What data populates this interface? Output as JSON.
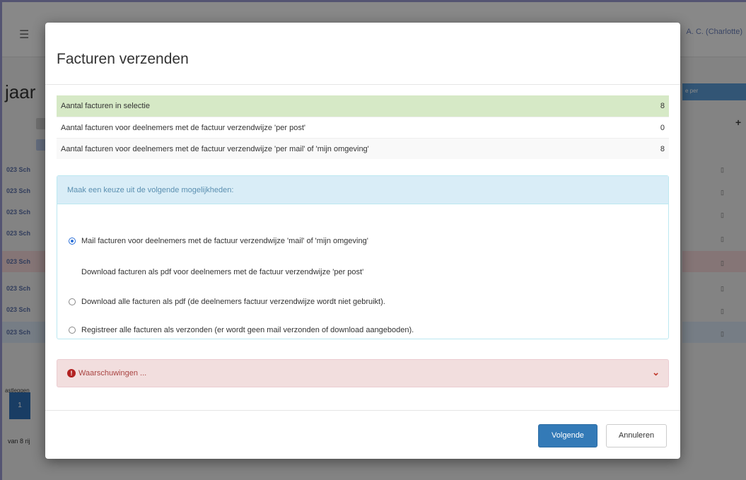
{
  "background": {
    "user_label": "A. C. (Charlotte)",
    "page_title": "jaar",
    "right_bar_label": "e per",
    "row_labels": [
      "023  Sch",
      "023  Sch",
      "023  Sch",
      "023  Sch",
      "023  Sch",
      "023  Sch",
      "023  Sch",
      "023  Sch"
    ],
    "bottom_small": "astleggen",
    "page_number": "1",
    "rows_count": "van 8 rij"
  },
  "modal": {
    "title": "Facturen verzenden",
    "stats": [
      {
        "label": "Aantal facturen in selectie",
        "value": "8"
      },
      {
        "label": "Aantal facturen voor deelnemers met de factuur verzendwijze 'per post'",
        "value": "0"
      },
      {
        "label": "Aantal facturen voor deelnemers met de factuur verzendwijze 'per mail' of 'mijn omgeving'",
        "value": "8"
      }
    ],
    "choice_header": "Maak een keuze uit de volgende mogelijkheden:",
    "options": [
      {
        "label": "Mail facturen voor deelnemers met de factuur verzendwijze 'mail' of 'mijn omgeving'",
        "selected": true
      },
      {
        "label": "Download facturen als pdf voor deelnemers met de factuur verzendwijze 'per post'",
        "selected": false
      },
      {
        "label": "Download alle facturen als pdf (de deelnemers factuur verzendwijze wordt niet gebruikt).",
        "selected": false
      },
      {
        "label": "Registreer alle facturen als verzonden (er wordt geen mail verzonden of download aangeboden).",
        "selected": false
      }
    ],
    "warnings_label": "Waarschuwingen ...",
    "next_button": "Volgende",
    "cancel_button": "Annuleren"
  },
  "colors": {
    "success_row": "#d6e9c6",
    "info_header": "#d9edf7",
    "danger_panel": "#f2dede",
    "primary": "#337ab7"
  }
}
